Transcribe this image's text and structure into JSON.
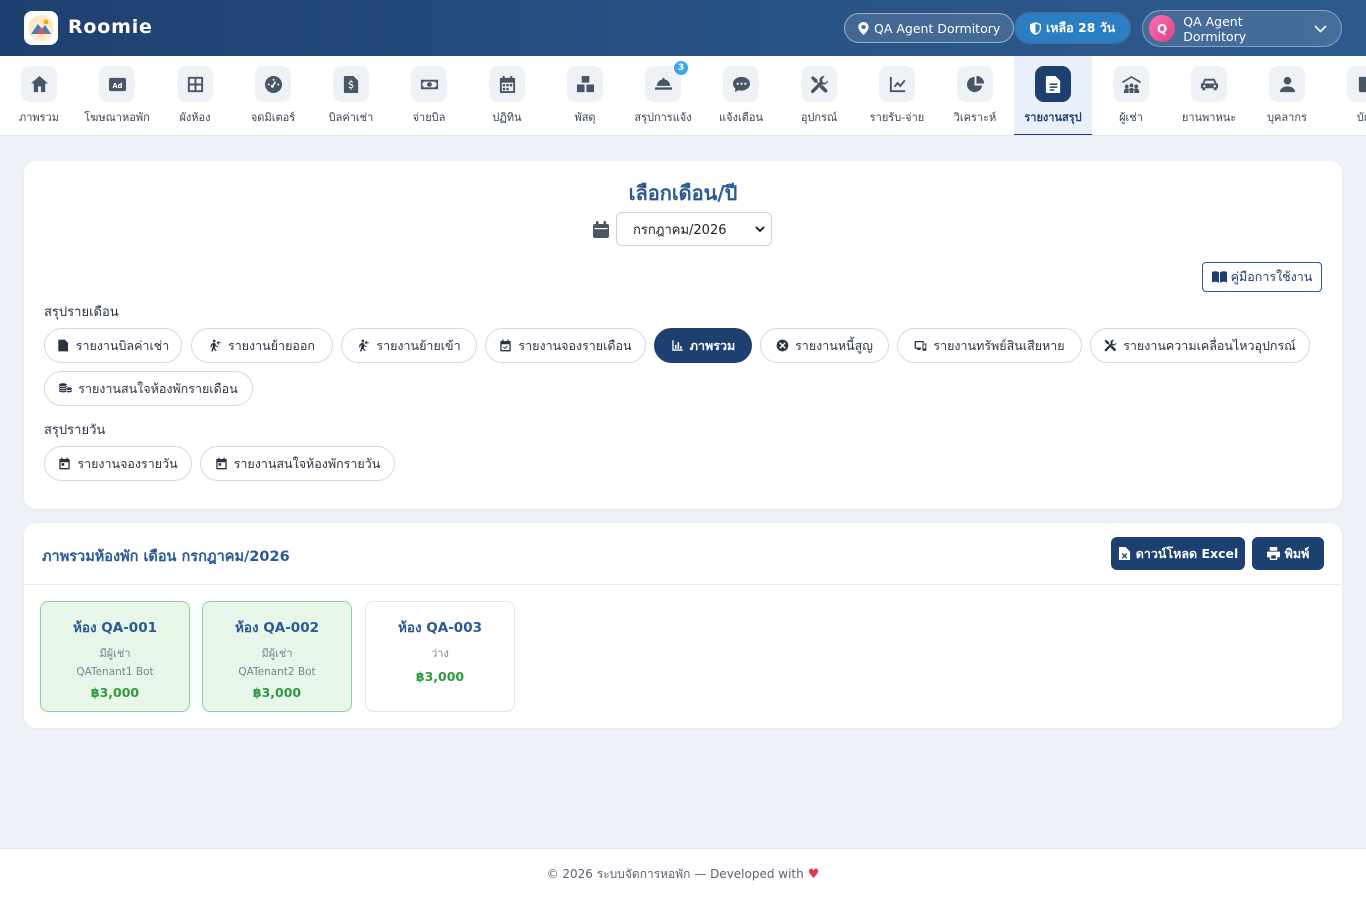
{
  "header": {
    "app_name": "Roomie",
    "location_label": "QA Agent Dormitory",
    "days_left_label": "เหลือ 28 วัน",
    "user_initial": "Q",
    "user_name": "QA Agent Dormitory"
  },
  "nav": {
    "items": [
      {
        "label": "ภาพรวม",
        "icon": "home-icon"
      },
      {
        "label": "โฆษณาหอพัก",
        "icon": "ad-icon"
      },
      {
        "label": "ผังห้อง",
        "icon": "grid-icon"
      },
      {
        "label": "จดมิเตอร์",
        "icon": "gauge-icon"
      },
      {
        "label": "บิลค่าเช่า",
        "icon": "invoice-icon"
      },
      {
        "label": "จ่ายบิล",
        "icon": "money-icon"
      },
      {
        "label": "ปฏิทิน",
        "icon": "calendar-icon"
      },
      {
        "label": "พัสดุ",
        "icon": "boxes-icon"
      },
      {
        "label": "สรุปการแจ้ง",
        "icon": "bell-service-icon",
        "badge": "3"
      },
      {
        "label": "แจ้งเตือน",
        "icon": "chat-icon"
      },
      {
        "label": "อุปกรณ์",
        "icon": "tools-icon"
      },
      {
        "label": "รายรับ-จ่าย",
        "icon": "line-chart-icon"
      },
      {
        "label": "วิเคราะห์",
        "icon": "pie-chart-icon"
      },
      {
        "label": "รายงานสรุป",
        "icon": "report-icon",
        "active": true
      },
      {
        "label": "ผู้เช่า",
        "icon": "people-roof-icon"
      },
      {
        "label": "ยานพาหนะ",
        "icon": "car-icon"
      },
      {
        "label": "บุคลากร",
        "icon": "user-icon"
      },
      {
        "label": "บัญ",
        "icon": "book-icon"
      }
    ]
  },
  "picker": {
    "title": "เลือกเดือน/ปี",
    "selected_month": "กรกฎาคม/2026",
    "guide_label": "คู่มือการใช้งาน"
  },
  "reports": {
    "monthly_label": "สรุปรายเดือน",
    "monthly": [
      {
        "label": "รายงานบิลค่าเช่า",
        "icon": "file-invoice-icon"
      },
      {
        "label": "รายงานย้ายออก",
        "icon": "person-walking-out-icon"
      },
      {
        "label": "รายงานย้ายเข้า",
        "icon": "person-walking-in-icon"
      },
      {
        "label": "รายงานจองรายเดือน",
        "icon": "calendar-check-icon"
      },
      {
        "label": "ภาพรวม",
        "icon": "bar-chart-icon",
        "active": true
      },
      {
        "label": "รายงานหนี้สูญ",
        "icon": "circle-x-icon"
      },
      {
        "label": "รายงานทรัพย์สินเสียหาย",
        "icon": "devices-icon"
      },
      {
        "label": "รายงานความเคลื่อนไหวอุปกรณ์",
        "icon": "tools-icon"
      },
      {
        "label": "รายงานสนใจห้องพักรายเดือน",
        "icon": "coins-icon"
      }
    ],
    "daily_label": "สรุปรายวัน",
    "daily": [
      {
        "label": "รายงานจองรายวัน",
        "icon": "calendar-day-icon"
      },
      {
        "label": "รายงานสนใจห้องพักรายวัน",
        "icon": "calendar-day-icon"
      }
    ]
  },
  "overview": {
    "title": "ภาพรวมห้องพัก เดือน กรกฎาคม/2026",
    "excel_label": "ดาวน์โหลด Excel",
    "print_label": "พิมพ์",
    "rooms": [
      {
        "name": "ห้อง QA-001",
        "status": "มีผู้เช่า",
        "tenant": "QATenant1 Bot",
        "price": "฿3,000",
        "occupied": true
      },
      {
        "name": "ห้อง QA-002",
        "status": "มีผู้เช่า",
        "tenant": "QATenant2 Bot",
        "price": "฿3,000",
        "occupied": true
      },
      {
        "name": "ห้อง QA-003",
        "status": "ว่าง",
        "tenant": "",
        "price": "฿3,000",
        "occupied": false
      }
    ]
  },
  "footer": {
    "text": "© 2026 ระบบจัดการหอพัก — Developed with"
  },
  "colors": {
    "primary": "#1e4070",
    "accent": "#2a5a93",
    "occupied_bg": "#e8f6e9",
    "price_green": "#2e9a3e",
    "badge_blue": "#3aa7e8"
  }
}
